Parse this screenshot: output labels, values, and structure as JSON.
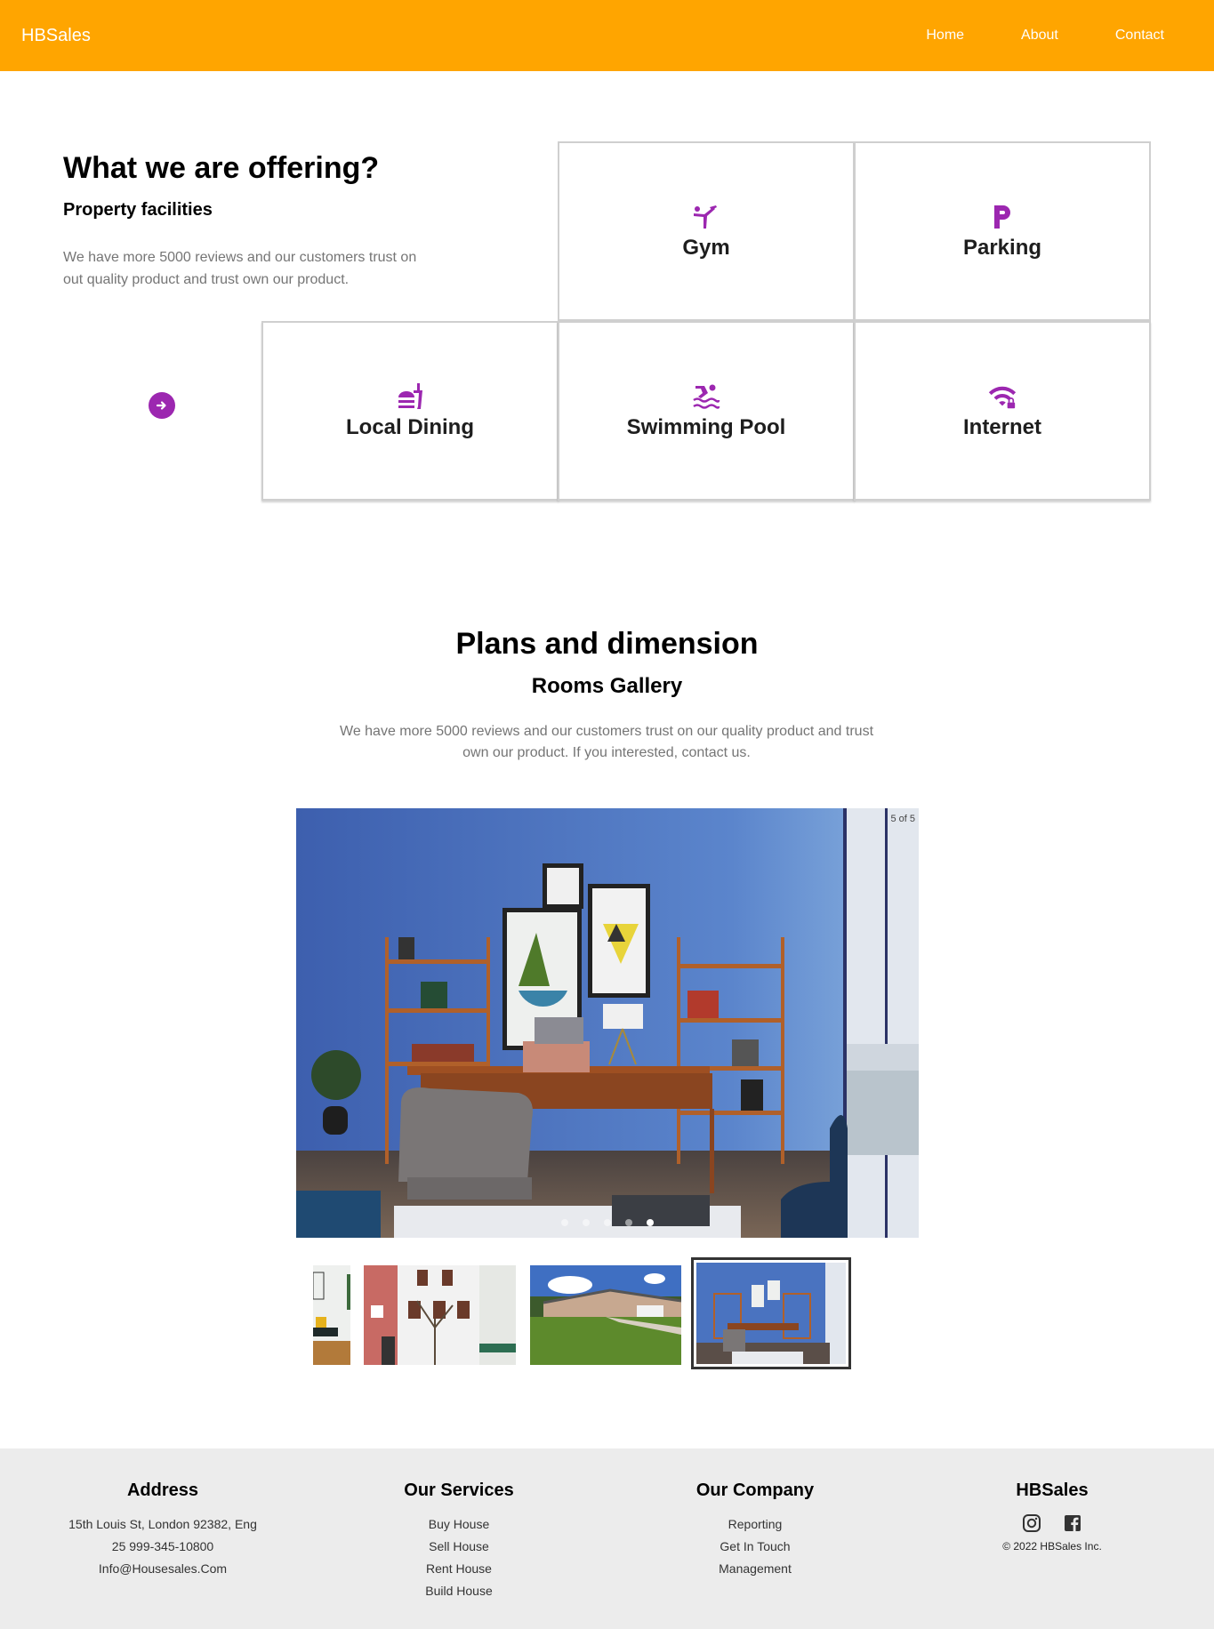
{
  "nav": {
    "brand": "HBSales",
    "links": [
      "Home",
      "About",
      "Contact"
    ]
  },
  "offering": {
    "title": "What we are offering?",
    "subtitle": "Property facilities",
    "description": "We have more 5000 reviews and our customers trust on out quality product and trust own our product.",
    "arrow_icon": "arrow-right-circle-icon",
    "facilities": [
      {
        "label": "Gym",
        "icon": "gymnastics-icon"
      },
      {
        "label": "Parking",
        "icon": "parking-icon"
      },
      {
        "label": "Local Dining",
        "icon": "fastfood-icon"
      },
      {
        "label": "Swimming Pool",
        "icon": "pool-icon"
      },
      {
        "label": "Internet",
        "icon": "wifi-lock-icon"
      }
    ],
    "accent_color": "#9c27b0"
  },
  "plans": {
    "title": "Plans and dimension",
    "subtitle": "Rooms Gallery",
    "description": "We have more 5000 reviews and our customers trust on our quality product and trust own our product. If you interested, contact us."
  },
  "gallery": {
    "counter": "5 of 5",
    "current_slide": 5,
    "total_slides": 5,
    "main_image": "blue office room with desk, shelves and chairs",
    "thumbnails": [
      {
        "alt": "white living room with yellow pillow",
        "active": false
      },
      {
        "alt": "colorful european townhouses",
        "active": false
      },
      {
        "alt": "suburban house with green lawn",
        "active": false
      },
      {
        "alt": "blue office room",
        "active": true
      }
    ]
  },
  "footer": {
    "address": {
      "heading": "Address",
      "lines": [
        "15th Louis St, London 92382, Eng",
        "25 999-345-10800",
        "Info@Housesales.Com"
      ]
    },
    "services": {
      "heading": "Our Services",
      "items": [
        "Buy House",
        "Sell House",
        "Rent House",
        "Build House"
      ]
    },
    "company": {
      "heading": "Our Company",
      "items": [
        "Reporting",
        "Get In Touch",
        "Management"
      ]
    },
    "brand": {
      "heading": "HBSales",
      "social": [
        "instagram-icon",
        "facebook-icon"
      ],
      "copyright": "© 2022 HBSales Inc."
    }
  },
  "colors": {
    "nav_bg": "#ffa500",
    "accent": "#9c27b0",
    "footer_bg": "#ececec",
    "muted_text": "#757575"
  }
}
